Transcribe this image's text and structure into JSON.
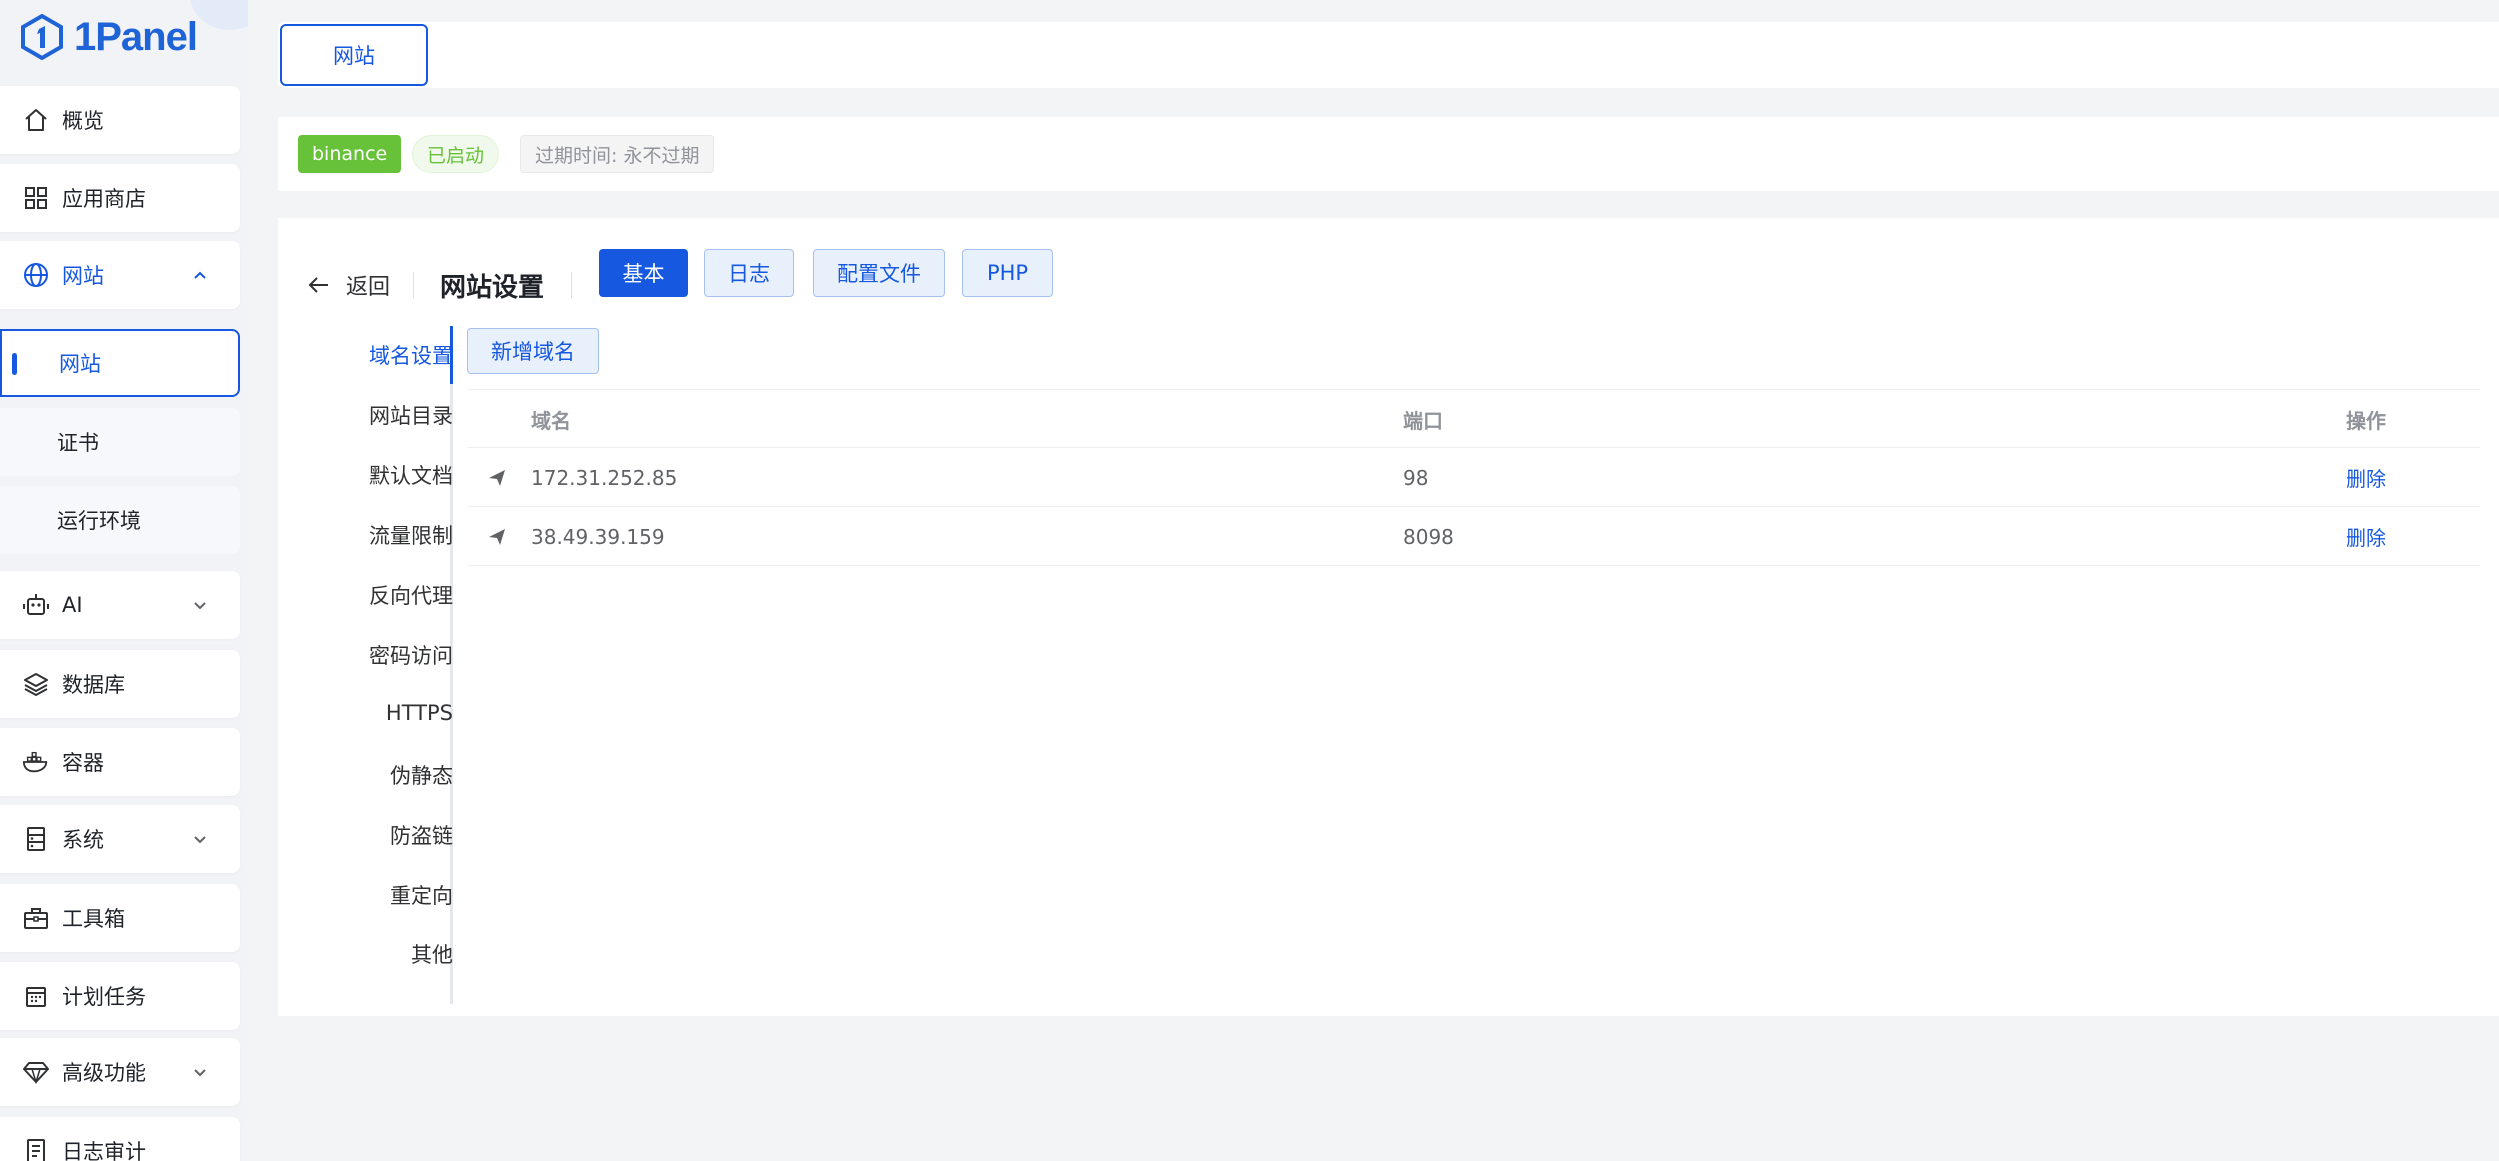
{
  "app": {
    "logo_text": "1Panel"
  },
  "sidebar": {
    "items": [
      {
        "label": "概览",
        "icon": "home-icon"
      },
      {
        "label": "应用商店",
        "icon": "grid-icon"
      },
      {
        "label": "网站",
        "icon": "globe-icon",
        "expanded": true
      },
      {
        "label": "AI",
        "icon": "robot-icon"
      },
      {
        "label": "数据库",
        "icon": "layers-icon"
      },
      {
        "label": "容器",
        "icon": "docker-icon"
      },
      {
        "label": "系统",
        "icon": "server-icon"
      },
      {
        "label": "工具箱",
        "icon": "toolbox-icon"
      },
      {
        "label": "计划任务",
        "icon": "calendar-icon"
      },
      {
        "label": "高级功能",
        "icon": "diamond-icon"
      },
      {
        "label": "日志审计",
        "icon": "log-icon"
      }
    ],
    "website_submenu": [
      {
        "label": "网站",
        "active": true
      },
      {
        "label": "证书"
      },
      {
        "label": "运行环境"
      }
    ]
  },
  "top_tab": {
    "label": "网站"
  },
  "status_bar": {
    "site_name": "binance",
    "status": "已启动",
    "expire": "过期时间: 永不过期"
  },
  "header": {
    "back_label": "返回",
    "title": "网站设置",
    "tabs": [
      "基本",
      "日志",
      "配置文件",
      "PHP"
    ],
    "active_tab": "基本"
  },
  "side_nav": {
    "items": [
      "域名设置",
      "网站目录",
      "默认文档",
      "流量限制",
      "反向代理",
      "密码访问",
      "HTTPS",
      "伪静态",
      "防盗链",
      "重定向",
      "其他"
    ],
    "active": "域名设置"
  },
  "domain_panel": {
    "add_button": "新增域名",
    "columns": {
      "domain": "域名",
      "port": "端口",
      "operation": "操作"
    },
    "rows": [
      {
        "domain": "172.31.252.85",
        "port": "98",
        "action": "删除"
      },
      {
        "domain": "38.49.39.159",
        "port": "8098",
        "action": "删除"
      }
    ]
  },
  "colors": {
    "primary": "#1658e0",
    "success": "#67c23a",
    "background": "#f3f4f6"
  }
}
